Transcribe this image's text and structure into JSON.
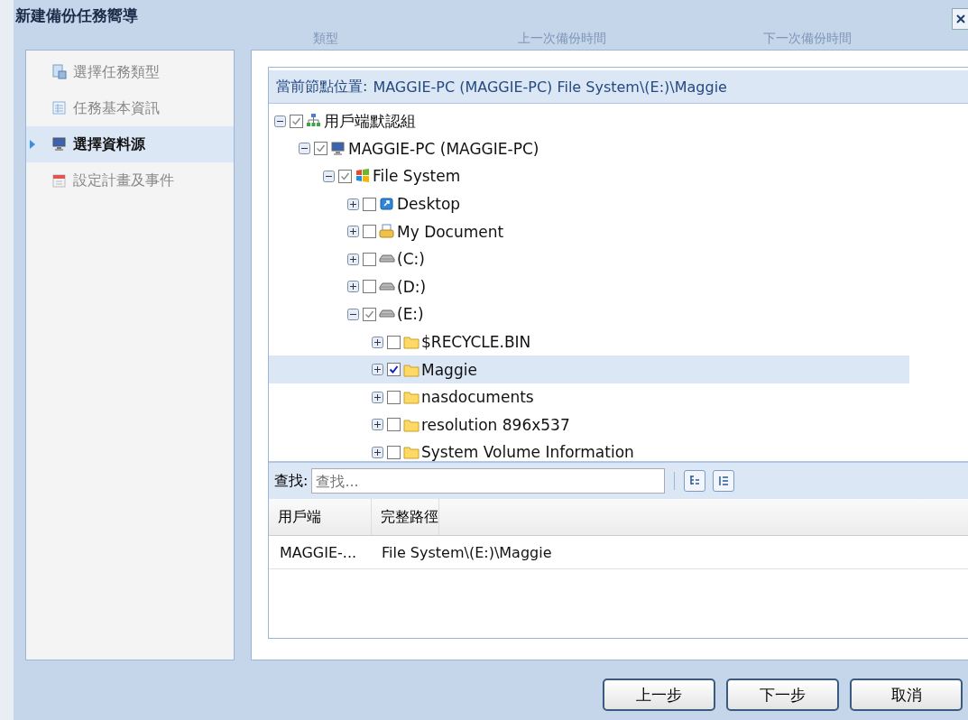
{
  "window": {
    "title": "新建備份任務嚮導",
    "background_columns": [
      "類型",
      "上一次備份時間",
      "下一次備份時間"
    ]
  },
  "steps": [
    {
      "label": "選擇任務類型",
      "kind": "type",
      "selected": false
    },
    {
      "label": "任務基本資訊",
      "kind": "info",
      "selected": false
    },
    {
      "label": "選擇資料源",
      "kind": "source",
      "selected": true
    },
    {
      "label": "設定計畫及事件",
      "kind": "schedule",
      "selected": false
    }
  ],
  "location": {
    "label": "當前節點位置:",
    "value": "MAGGIE-PC (MAGGIE-PC) File System\\(E:)\\Maggie"
  },
  "tree": [
    {
      "label": "用戶端默認組",
      "kind": "group",
      "expanded": true,
      "checked": true,
      "selected": false,
      "children": [
        {
          "label": "MAGGIE-PC (MAGGIE-PC)",
          "kind": "computer",
          "expanded": true,
          "checked": true,
          "selected": false,
          "children": [
            {
              "label": "File System",
              "kind": "filesystem",
              "expanded": true,
              "checked": true,
              "selected": false,
              "children": [
                {
                  "label": "Desktop",
                  "kind": "desktop",
                  "expanded": false,
                  "checked": false,
                  "selected": false
                },
                {
                  "label": "My Document",
                  "kind": "document",
                  "expanded": false,
                  "checked": false,
                  "selected": false
                },
                {
                  "label": "(C:)",
                  "kind": "drive",
                  "expanded": false,
                  "checked": false,
                  "selected": false
                },
                {
                  "label": "(D:)",
                  "kind": "drive",
                  "expanded": false,
                  "checked": false,
                  "selected": false
                },
                {
                  "label": "(E:)",
                  "kind": "drive",
                  "expanded": true,
                  "checked": true,
                  "selected": false,
                  "children": [
                    {
                      "label": "$RECYCLE.BIN",
                      "kind": "folder",
                      "expanded": false,
                      "checked": false,
                      "selected": false
                    },
                    {
                      "label": "Maggie",
                      "kind": "folder",
                      "expanded": false,
                      "checked": true,
                      "selected": true
                    },
                    {
                      "label": "nasdocuments",
                      "kind": "folder",
                      "expanded": false,
                      "checked": false,
                      "selected": false
                    },
                    {
                      "label": "resolution 896x537",
                      "kind": "folder",
                      "expanded": false,
                      "checked": false,
                      "selected": false
                    },
                    {
                      "label": "System Volume Information",
                      "kind": "folder",
                      "expanded": false,
                      "checked": false,
                      "selected": false
                    }
                  ]
                }
              ]
            }
          ]
        }
      ]
    }
  ],
  "search": {
    "label": "查找:",
    "placeholder": "查找..."
  },
  "table": {
    "columns": [
      "用戶端",
      "完整路徑"
    ],
    "rows": [
      [
        "MAGGIE-...",
        "File System\\(E:)\\Maggie"
      ]
    ]
  },
  "buttons": [
    "上一步",
    "下一步",
    "取消"
  ]
}
